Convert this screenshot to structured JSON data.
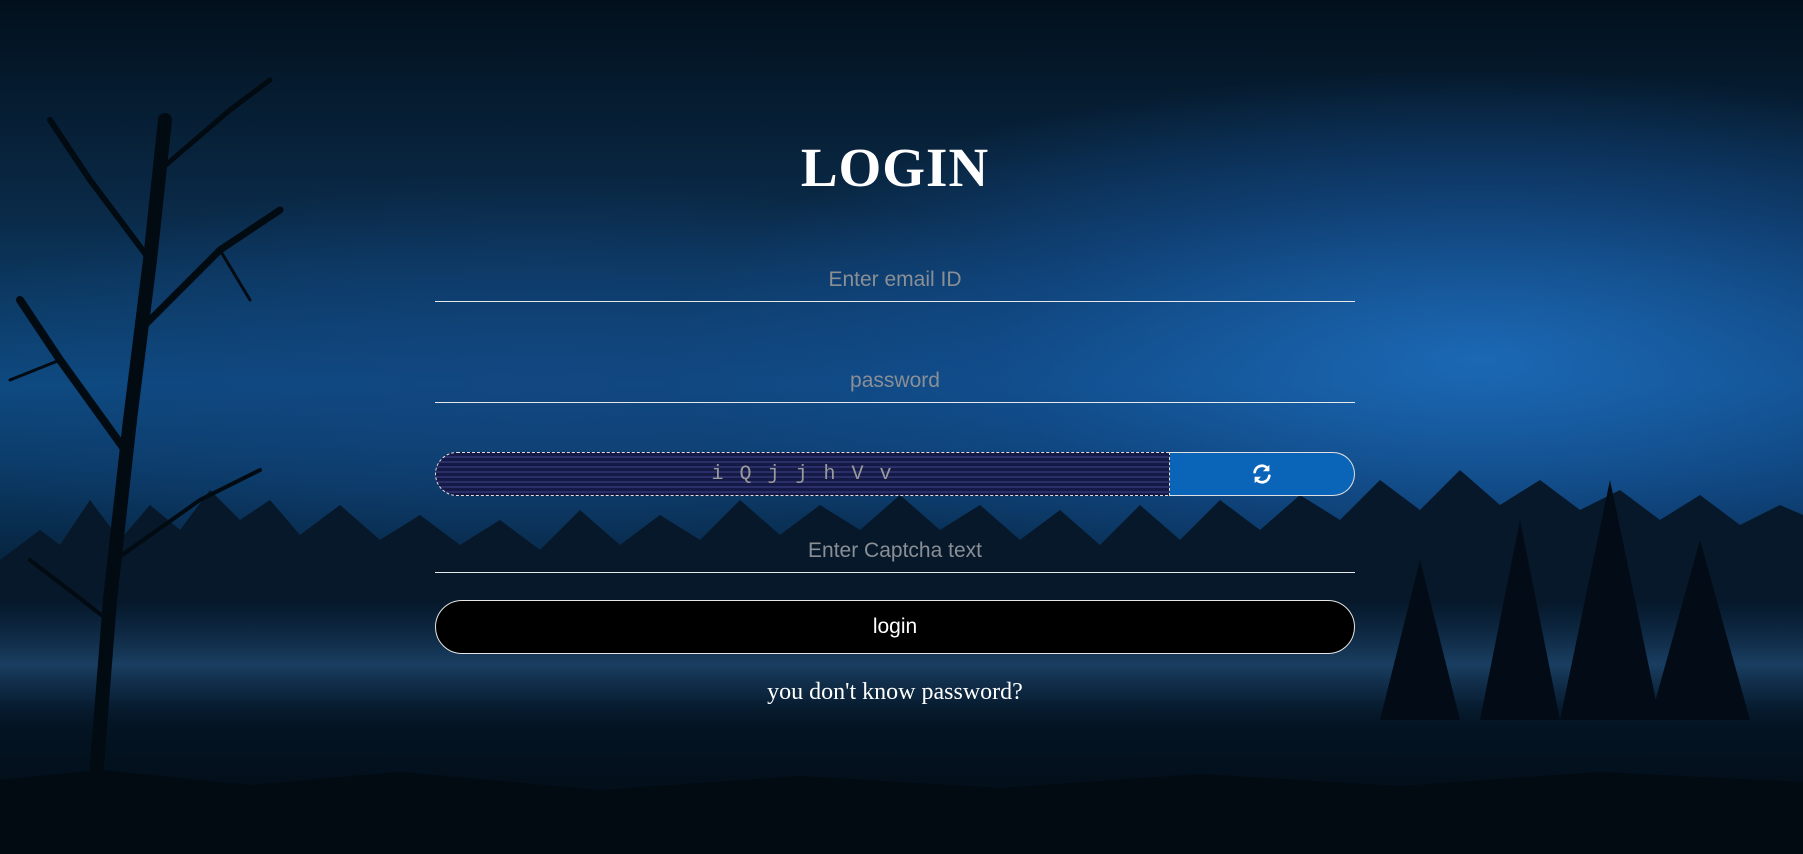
{
  "heading": "LOGIN",
  "email": {
    "placeholder": "Enter email ID",
    "value": ""
  },
  "password": {
    "placeholder": "password",
    "value": ""
  },
  "captcha": {
    "text": "i Q j j h V v",
    "input_placeholder": "Enter Captcha text",
    "input_value": "",
    "refresh_icon": "refresh-icon"
  },
  "login_button": "login",
  "forgot_link": "you don't know password?",
  "colors": {
    "refresh_button": "#0a64b8",
    "login_button": "#000000",
    "text": "#ffffff",
    "placeholder": "#8a8f96"
  }
}
